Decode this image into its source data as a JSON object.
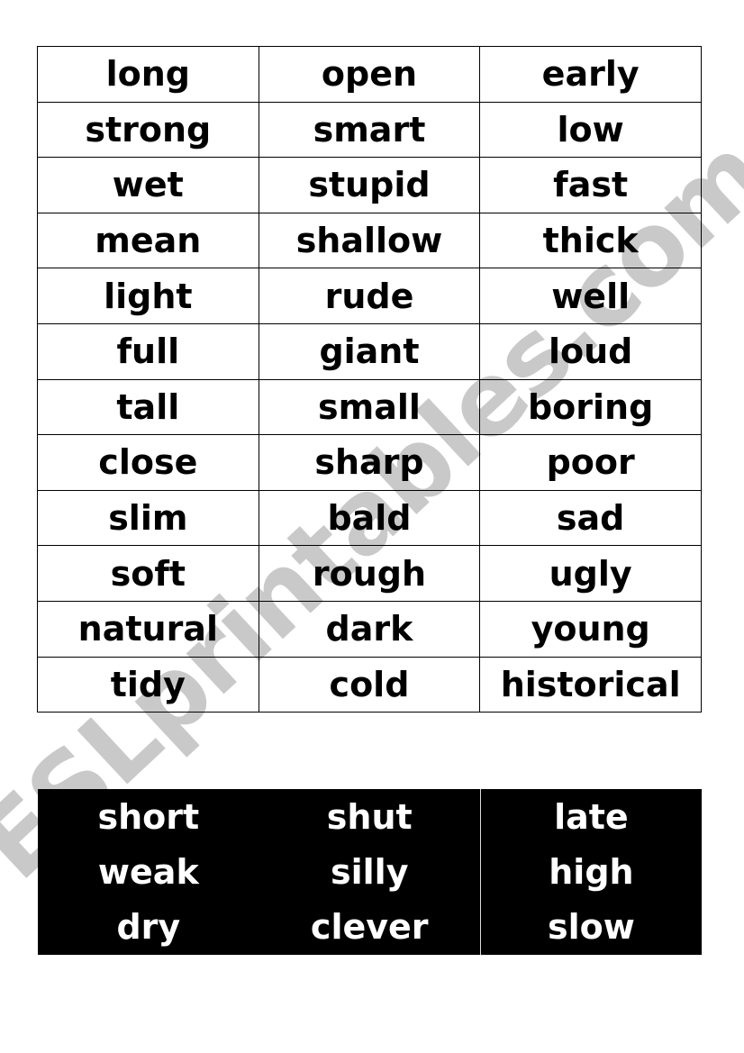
{
  "watermark": "ESLprintables.com",
  "top_table": {
    "rows": [
      [
        "long",
        "open",
        "early"
      ],
      [
        "strong",
        "smart",
        "low"
      ],
      [
        "wet",
        "stupid",
        "fast"
      ],
      [
        "mean",
        "shallow",
        "thick"
      ],
      [
        "light",
        "rude",
        "well"
      ],
      [
        "full",
        "giant",
        "loud"
      ],
      [
        "tall",
        "small",
        "boring"
      ],
      [
        "close",
        "sharp",
        "poor"
      ],
      [
        "slim",
        "bald",
        "sad"
      ],
      [
        "soft",
        "rough",
        "ugly"
      ],
      [
        "natural",
        "dark",
        "young"
      ],
      [
        "tidy",
        "cold",
        "historical"
      ]
    ]
  },
  "bottom_table": {
    "rows": [
      [
        "short",
        "shut",
        "late"
      ],
      [
        "weak",
        "silly",
        "high"
      ],
      [
        "dry",
        "clever",
        "slow"
      ]
    ]
  }
}
